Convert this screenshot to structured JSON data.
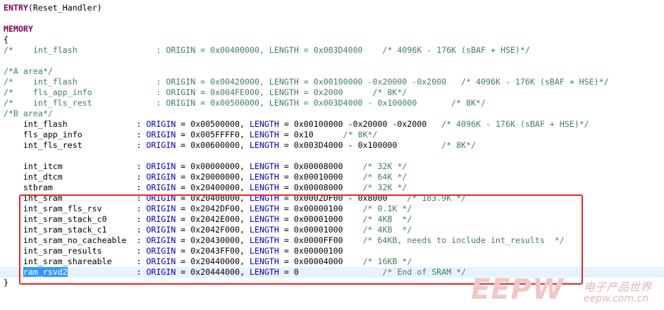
{
  "editor": {
    "lines": [
      {
        "id": "l1",
        "segments": [
          {
            "c": "kw",
            "t": "ENTRY"
          },
          {
            "c": "txt",
            "t": "(Reset_Handler)"
          }
        ]
      },
      {
        "id": "l2",
        "segments": []
      },
      {
        "id": "l3",
        "segments": [
          {
            "c": "kw",
            "t": "MEMORY"
          }
        ]
      },
      {
        "id": "l4",
        "segments": [
          {
            "c": "txt",
            "t": "{"
          }
        ]
      },
      {
        "id": "l5",
        "segments": [
          {
            "c": "cmt",
            "t": "/*    int_flash                : ORIGIN = 0x00400000, LENGTH = 0x003D4000    /* 4096K - 176K (sBAF + HSE)*/"
          }
        ]
      },
      {
        "id": "l6",
        "segments": []
      },
      {
        "id": "l7",
        "segments": [
          {
            "c": "cmt",
            "t": "/*A area*/"
          }
        ]
      },
      {
        "id": "l8",
        "segments": [
          {
            "c": "cmt",
            "t": "/*    int_flash                : ORIGIN = 0x00420000, LENGTH = 0x00100000 -0x20000 -0x2000   /* 4096K - 176K (sBAF + HSE)*/"
          }
        ]
      },
      {
        "id": "l9",
        "segments": [
          {
            "c": "cmt",
            "t": "/*    fls_app_info             : ORIGIN = 0x004FE000, LENGTH = 0x2000      /* 8K*/"
          }
        ]
      },
      {
        "id": "l10",
        "segments": [
          {
            "c": "cmt",
            "t": "/*    int_fls_rest             : ORIGIN = 0x00500000, LENGTH = 0x003D4000 - 0x100000       /* 8K*/"
          }
        ]
      },
      {
        "id": "l11",
        "segments": [
          {
            "c": "cmt",
            "t": "/*B area*/"
          }
        ]
      },
      {
        "id": "l12",
        "segments": [
          {
            "c": "txt",
            "t": "    int_flash              : "
          },
          {
            "c": "attr",
            "t": "ORIGIN"
          },
          {
            "c": "txt",
            "t": " = 0x00500000, "
          },
          {
            "c": "attr",
            "t": "LENGTH"
          },
          {
            "c": "txt",
            "t": " = 0x00100000 -0x20000 -0x2000   "
          },
          {
            "c": "cmt",
            "t": "/* 4096K - 176K (sBAF + HSE)*/"
          }
        ]
      },
      {
        "id": "l13",
        "segments": [
          {
            "c": "txt",
            "t": "    fls_app_info           : "
          },
          {
            "c": "attr",
            "t": "ORIGIN"
          },
          {
            "c": "txt",
            "t": " = 0x005FFFF0, "
          },
          {
            "c": "attr",
            "t": "LENGTH"
          },
          {
            "c": "txt",
            "t": " = 0x10      "
          },
          {
            "c": "cmt",
            "t": "/* 8K*/"
          }
        ]
      },
      {
        "id": "l14",
        "segments": [
          {
            "c": "txt",
            "t": "    int_fls_rest           : "
          },
          {
            "c": "attr",
            "t": "ORIGIN"
          },
          {
            "c": "txt",
            "t": " = 0x00600000, "
          },
          {
            "c": "attr",
            "t": "LENGTH"
          },
          {
            "c": "txt",
            "t": " = 0x003D4000 - 0x100000         "
          },
          {
            "c": "cmt",
            "t": "/* 8K*/"
          }
        ]
      },
      {
        "id": "l15",
        "segments": []
      },
      {
        "id": "l16",
        "segments": [
          {
            "c": "txt",
            "t": "    int_itcm               : "
          },
          {
            "c": "attr",
            "t": "ORIGIN"
          },
          {
            "c": "txt",
            "t": " = 0x00000000, "
          },
          {
            "c": "attr",
            "t": "LENGTH"
          },
          {
            "c": "txt",
            "t": " = 0x00008000    "
          },
          {
            "c": "cmt",
            "t": "/* 32K */"
          }
        ]
      },
      {
        "id": "l17",
        "segments": [
          {
            "c": "txt",
            "t": "    int_dtcm               : "
          },
          {
            "c": "attr",
            "t": "ORIGIN"
          },
          {
            "c": "txt",
            "t": " = 0x20000000, "
          },
          {
            "c": "attr",
            "t": "LENGTH"
          },
          {
            "c": "txt",
            "t": " = 0x00010000    "
          },
          {
            "c": "cmt",
            "t": "/* 64K */"
          }
        ]
      },
      {
        "id": "l18",
        "segments": [
          {
            "c": "txt",
            "t": "    stbram                 : "
          },
          {
            "c": "attr",
            "t": "ORIGIN"
          },
          {
            "c": "txt",
            "t": " = 0x20400000, "
          },
          {
            "c": "attr",
            "t": "LENGTH"
          },
          {
            "c": "txt",
            "t": " = 0x00008000    "
          },
          {
            "c": "cmt",
            "t": "/* 32K */"
          }
        ]
      },
      {
        "id": "l19",
        "segments": [
          {
            "c": "txt",
            "t": "    int_sram               : "
          },
          {
            "c": "attr",
            "t": "ORIGIN"
          },
          {
            "c": "txt",
            "t": " = 0x20408000, "
          },
          {
            "c": "attr",
            "t": "LENGTH"
          },
          {
            "c": "txt",
            "t": " = 0x0002DF00 - 0x8000    "
          },
          {
            "c": "cmt",
            "t": "/* 183.9K */"
          }
        ]
      },
      {
        "id": "l20",
        "segments": [
          {
            "c": "txt",
            "t": "    int_sram_fls_rsv       : "
          },
          {
            "c": "attr",
            "t": "ORIGIN"
          },
          {
            "c": "txt",
            "t": " = 0x2042DF00, "
          },
          {
            "c": "attr",
            "t": "LENGTH"
          },
          {
            "c": "txt",
            "t": " = 0x00000100    "
          },
          {
            "c": "cmt",
            "t": "/* 0.1K */"
          }
        ]
      },
      {
        "id": "l21",
        "segments": [
          {
            "c": "txt",
            "t": "    int_sram_stack_c0      : "
          },
          {
            "c": "attr",
            "t": "ORIGIN"
          },
          {
            "c": "txt",
            "t": " = 0x2042E000, "
          },
          {
            "c": "attr",
            "t": "LENGTH"
          },
          {
            "c": "txt",
            "t": " = 0x00001000    "
          },
          {
            "c": "cmt",
            "t": "/* 4KB  */"
          }
        ]
      },
      {
        "id": "l22",
        "segments": [
          {
            "c": "txt",
            "t": "    int_sram_stack_c1      : "
          },
          {
            "c": "attr",
            "t": "ORIGIN"
          },
          {
            "c": "txt",
            "t": " = 0x2042F000, "
          },
          {
            "c": "attr",
            "t": "LENGTH"
          },
          {
            "c": "txt",
            "t": " = 0x00001000    "
          },
          {
            "c": "cmt",
            "t": "/* 4KB  */"
          }
        ]
      },
      {
        "id": "l23",
        "segments": [
          {
            "c": "txt",
            "t": "    int_sram_no_cacheable  : "
          },
          {
            "c": "attr",
            "t": "ORIGIN"
          },
          {
            "c": "txt",
            "t": " = 0x20430000, "
          },
          {
            "c": "attr",
            "t": "LENGTH"
          },
          {
            "c": "txt",
            "t": " = 0x0000FF00    "
          },
          {
            "c": "cmt",
            "t": "/* 64KB, needs to include int_results  */"
          }
        ]
      },
      {
        "id": "l24",
        "segments": [
          {
            "c": "txt",
            "t": "    int_sram_results       : "
          },
          {
            "c": "attr",
            "t": "ORIGIN"
          },
          {
            "c": "txt",
            "t": " = 0x2043FF00, "
          },
          {
            "c": "attr",
            "t": "LENGTH"
          },
          {
            "c": "txt",
            "t": " = 0x00000100"
          }
        ]
      },
      {
        "id": "l25",
        "segments": [
          {
            "c": "txt",
            "t": "    int_sram_shareable     : "
          },
          {
            "c": "attr",
            "t": "ORIGIN"
          },
          {
            "c": "txt",
            "t": " = 0x20440000, "
          },
          {
            "c": "attr",
            "t": "LENGTH"
          },
          {
            "c": "txt",
            "t": " = 0x00004000    "
          },
          {
            "c": "cmt",
            "t": "/* 16KB */"
          }
        ]
      },
      {
        "id": "l26",
        "current": true,
        "segments": [
          {
            "c": "txt",
            "t": "    "
          },
          {
            "c": "sel",
            "t": "ram_rsvd2"
          },
          {
            "c": "txt",
            "t": "              : "
          },
          {
            "c": "attr",
            "t": "ORIGIN"
          },
          {
            "c": "txt",
            "t": " = 0x20444000, "
          },
          {
            "c": "attr",
            "t": "LENGTH"
          },
          {
            "c": "txt",
            "t": " = 0                 "
          },
          {
            "c": "cmt",
            "t": "/* End of SRAM */"
          }
        ]
      },
      {
        "id": "l27",
        "segments": [
          {
            "c": "txt",
            "t": "}"
          }
        ]
      }
    ]
  },
  "watermark": {
    "logo": "EEPW",
    "cn": "电子产品世界",
    "url": "eepw.com.cn"
  },
  "colors": {
    "highlight_box": "#e8262a",
    "selection": "#3399ff",
    "current_line": "#e8f2fe",
    "keyword": "#7f0055",
    "comment": "#3f7f5f"
  }
}
